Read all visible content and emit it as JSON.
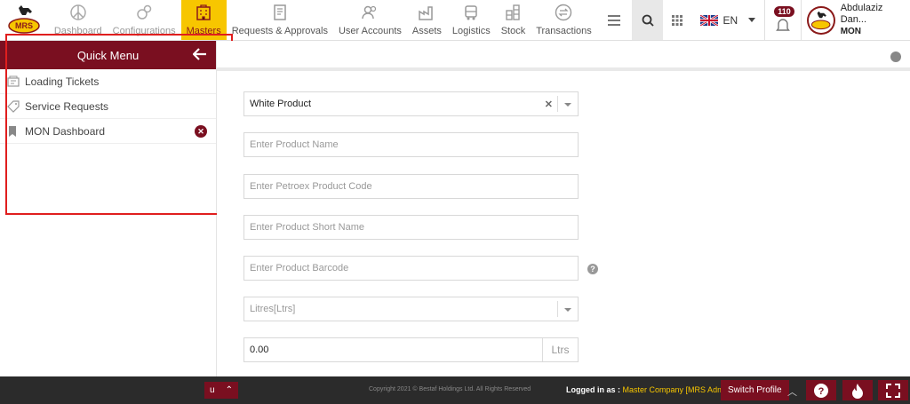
{
  "nav": {
    "logo_text": "MRS",
    "items": [
      {
        "label": "Dashboard",
        "icon": "peace-icon"
      },
      {
        "label": "Configurations",
        "icon": "gears-icon"
      },
      {
        "label": "Masters",
        "icon": "buildings-icon"
      },
      {
        "label": "Requests & Approvals",
        "icon": "document-icon"
      },
      {
        "label": "User Accounts",
        "icon": "users-icon"
      },
      {
        "label": "Assets",
        "icon": "factory-icon"
      },
      {
        "label": "Logistics",
        "icon": "truck-icon"
      },
      {
        "label": "Stock",
        "icon": "barrels-icon"
      },
      {
        "label": "Transactions",
        "icon": "exchange-icon"
      }
    ],
    "language": "EN",
    "notification_count": "110",
    "user_name": "Abdulaziz Dan...",
    "user_org": "MON"
  },
  "quick_menu": {
    "title": "Quick Menu",
    "items": [
      {
        "label": "Loading Tickets"
      },
      {
        "label": "Service Requests"
      },
      {
        "label": "MON Dashboard"
      }
    ]
  },
  "form": {
    "product_type": "White Product",
    "product_name_placeholder": "Enter Product Name",
    "petroex_code_placeholder": "Enter Petroex Product Code",
    "short_name_placeholder": "Enter Product Short Name",
    "barcode_placeholder": "Enter Product Barcode",
    "unit_selected": "Litres[Ltrs]",
    "quantity_value": "0.00",
    "quantity_unit": "Ltrs"
  },
  "footer": {
    "copyright": "Copyright 2021 © Bestaf Holdings Ltd. All Rights Reserved",
    "logged_in_label": "Logged in as :",
    "logged_in_value": "Master Company [MRS Admin]",
    "switch_profile": "Switch Profile",
    "left_tab_text": "u"
  },
  "colors": {
    "brand": "#7a0f20",
    "active_nav": "#f7c600",
    "highlight_box": "#e01e1e"
  }
}
